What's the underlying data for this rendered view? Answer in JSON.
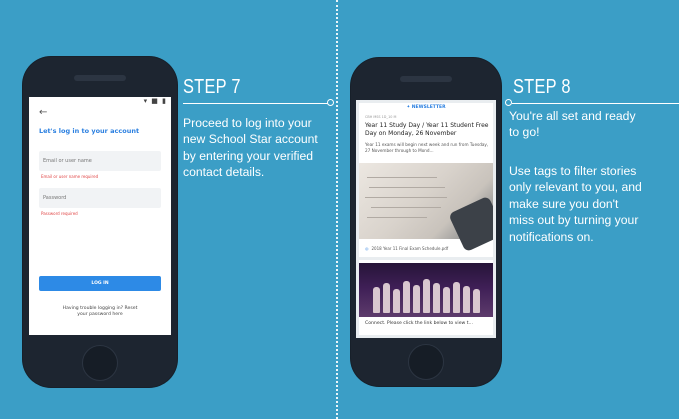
{
  "colors": {
    "background": "#3b9ec6",
    "phone_body": "#1d2530",
    "accent": "#2d8ae6",
    "error": "#e04545"
  },
  "step7": {
    "label": "STEP 7",
    "lines": [
      "Proceed to log into your",
      "new School Star account",
      "by entering your verified",
      "contact details."
    ]
  },
  "step8": {
    "label": "STEP 8",
    "lines_a": [
      "You're all set and ready",
      "to go!"
    ],
    "lines_b": [
      "Use tags to filter stories",
      "only relevant to you, and",
      "make sure you don't",
      "miss out by turning your",
      "notifications on."
    ]
  },
  "login": {
    "status": "▾ ■ ▮",
    "back": "←",
    "title": "Let's log in to your account",
    "email_placeholder": "Email or user name",
    "email_error": "Email or user name required",
    "password_placeholder": "Password",
    "password_error": "Password required",
    "login_button": "LOG IN",
    "trouble_line1": "Having trouble logging in? Reset",
    "trouble_line2": "your password here"
  },
  "newsletter": {
    "header": "NEWSLETTER",
    "meta": "CBH    MSS 1D_10 M",
    "title": "Year 11 Study Day / Year 11 Student Free Day on Monday, 26 November",
    "excerpt": "Year 11 exams will begin next week and run from Tuesday, 27 November through to Mond...",
    "attachment": "2018 Year 11 Final Exam Schedule.pdf",
    "connect": "Connect. Please click the link below to view t..."
  }
}
